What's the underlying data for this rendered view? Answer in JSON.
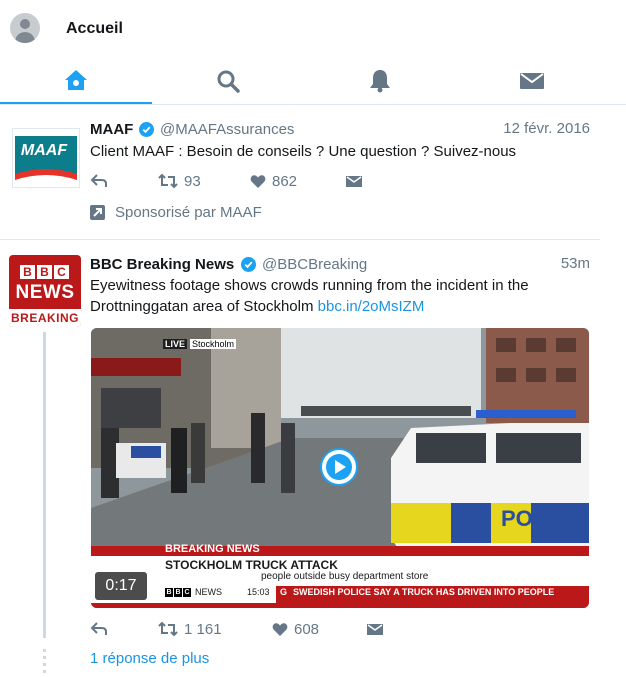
{
  "header": {
    "title": "Accueil"
  },
  "tabs": [
    {
      "icon": "home-icon",
      "active": true
    },
    {
      "icon": "search-icon",
      "active": false
    },
    {
      "icon": "bell-icon",
      "active": false
    },
    {
      "icon": "mail-icon",
      "active": false
    }
  ],
  "colors": {
    "accent": "#1da1f2",
    "link": "#1b95e0",
    "muted": "#657786",
    "maaf_teal": "#0c7d8a",
    "maaf_red": "#e63329",
    "bbc_red": "#bb1919"
  },
  "tweets": [
    {
      "name": "MAAF",
      "handle": "@MAAFAssurances",
      "time": "12 févr. 2016",
      "text": "Client MAAF : Besoin de conseils ? Une question ? Suivez-nous",
      "retweets": "93",
      "likes": "862",
      "sponsored": "Sponsorisé par MAAF",
      "logo_text": "MAAF"
    },
    {
      "name": "BBC Breaking News",
      "handle": "@BBCBreaking",
      "time": "53m",
      "text": "Eyewitness footage shows crowds running from the incident in the Drottninggatan area of Stockholm",
      "link": "bbc.in/2oMsIZM",
      "retweets": "1 161",
      "likes": "608",
      "more_replies": "1 réponse de plus",
      "logo": {
        "bbc": [
          "B",
          "B",
          "C"
        ],
        "news": "NEWS",
        "breaking": "BREAKING"
      },
      "video": {
        "live": "LIVE",
        "location": "Stockholm",
        "breaking": "BREAKING NEWS",
        "headline": "STOCKHOLM TRUCK ATTACK",
        "subline": "people outside busy department store",
        "duration": "0:17",
        "clock": "15:03",
        "ticker_tag": "G",
        "ticker": "SWEDISH POLICE SAY A TRUCK HAS DRIVEN INTO PEOPLE",
        "brand_news": "NEWS",
        "police_text": "POLIS"
      }
    }
  ]
}
